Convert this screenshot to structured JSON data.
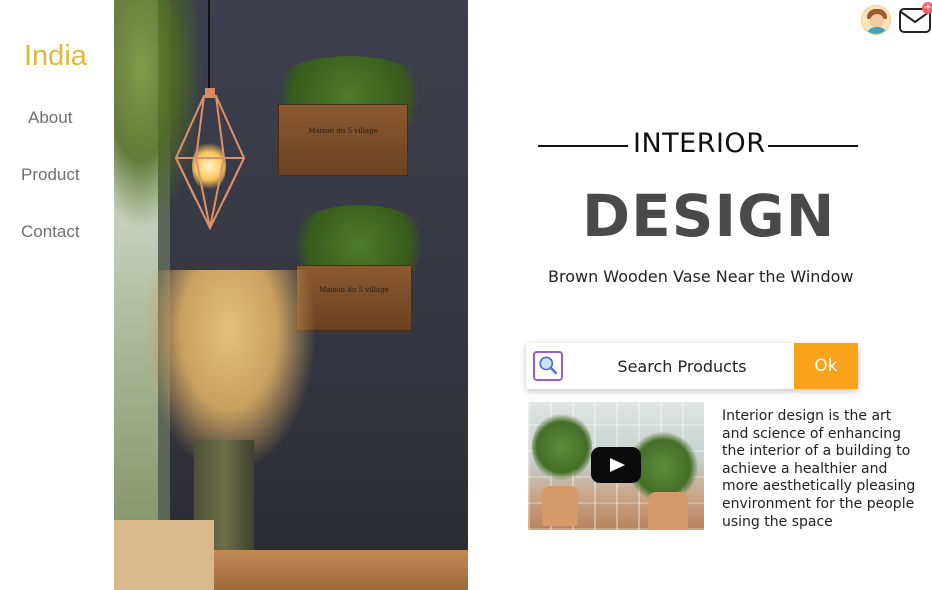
{
  "brand": {
    "name": "India",
    "color": "#e1b93a"
  },
  "nav": {
    "items": [
      {
        "label": "About"
      },
      {
        "label": "Product"
      },
      {
        "label": "Contact"
      }
    ]
  },
  "hero": {
    "planter_labels": [
      "Maison du 5 village",
      "Maison du 5 village"
    ]
  },
  "header_icons": {
    "avatar": "user-avatar-icon",
    "mail": "mail-icon",
    "mail_badge": "+"
  },
  "headline": {
    "overline": "INTERIOR",
    "title": "DESIGN",
    "subtitle": "Brown Wooden Vase Near the Window"
  },
  "search": {
    "placeholder": "Search Products",
    "button_label": "Ok",
    "button_color": "#f9a21b",
    "icon": "search-icon"
  },
  "video": {
    "icon": "play-icon"
  },
  "description": {
    "text": "Interior design is the art and science of enhancing the interior of a building to achieve a healthier and more aesthetically pleasing environment for the people using the space"
  }
}
